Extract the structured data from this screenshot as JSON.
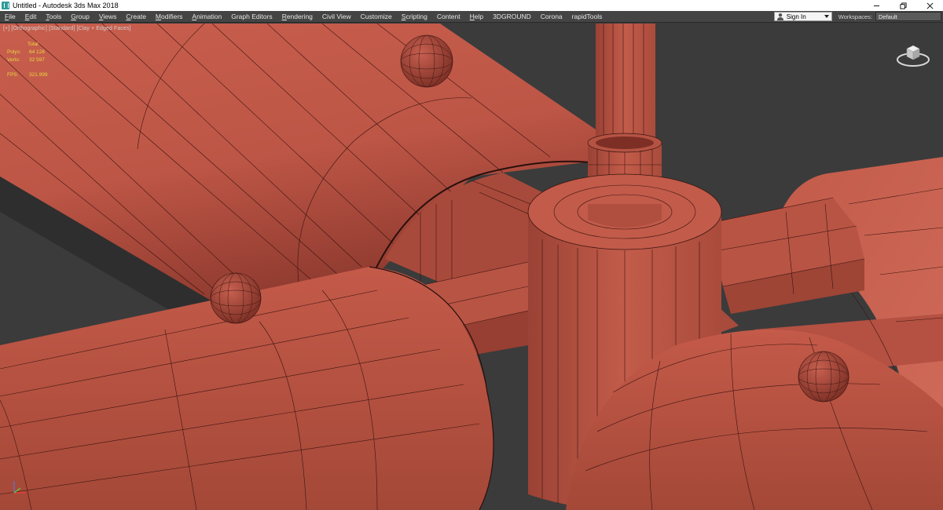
{
  "window": {
    "title": "Untitled - Autodesk 3ds Max 2018"
  },
  "menu": {
    "items": [
      {
        "label": "File",
        "underline": "F",
        "rest": "ile"
      },
      {
        "label": "Edit",
        "underline": "E",
        "rest": "dit"
      },
      {
        "label": "Tools",
        "underline": "T",
        "rest": "ools"
      },
      {
        "label": "Group",
        "underline": "G",
        "rest": "roup"
      },
      {
        "label": "Views",
        "underline": "V",
        "rest": "iews"
      },
      {
        "label": "Create",
        "underline": "C",
        "rest": "reate"
      },
      {
        "label": "Modifiers",
        "underline": "M",
        "rest": "odifiers"
      },
      {
        "label": "Animation",
        "underline": "A",
        "rest": "nimation"
      },
      {
        "label": "Graph Editors",
        "underline": "",
        "rest": "Graph Editors"
      },
      {
        "label": "Rendering",
        "underline": "R",
        "rest": "endering"
      },
      {
        "label": "Civil View",
        "underline": "",
        "rest": "Civil View"
      },
      {
        "label": "Customize",
        "underline": "",
        "rest": "Customize"
      },
      {
        "label": "Scripting",
        "underline": "S",
        "rest": "cripting"
      },
      {
        "label": "Content",
        "underline": "",
        "rest": "Content"
      },
      {
        "label": "Help",
        "underline": "H",
        "rest": "elp"
      },
      {
        "label": "3DGROUND",
        "underline": "",
        "rest": "3DGROUND"
      },
      {
        "label": "Corona",
        "underline": "",
        "rest": "Corona"
      },
      {
        "label": "rapidTools",
        "underline": "",
        "rest": "rapidTools"
      }
    ],
    "signin_label": "Sign In",
    "workspaces_label": "Workspaces:",
    "workspace_value": "Default"
  },
  "viewport": {
    "label": "[+] [Orthographic] [Standard] [Clay + Edged Faces]",
    "stats": {
      "heading": "Total",
      "polys_label": "Polys:",
      "polys_value": "64 128",
      "verts_label": "Verts:",
      "verts_value": "32 597",
      "fps_label": "FPS:",
      "fps_value": "321.999"
    }
  },
  "colors": {
    "clay": "#c05a4a",
    "clay_dark": "#8e3c30",
    "clay_light": "#d06a58",
    "wire": "#3a1410",
    "background": "#3b3b3b",
    "stats_text": "#e8d840"
  }
}
